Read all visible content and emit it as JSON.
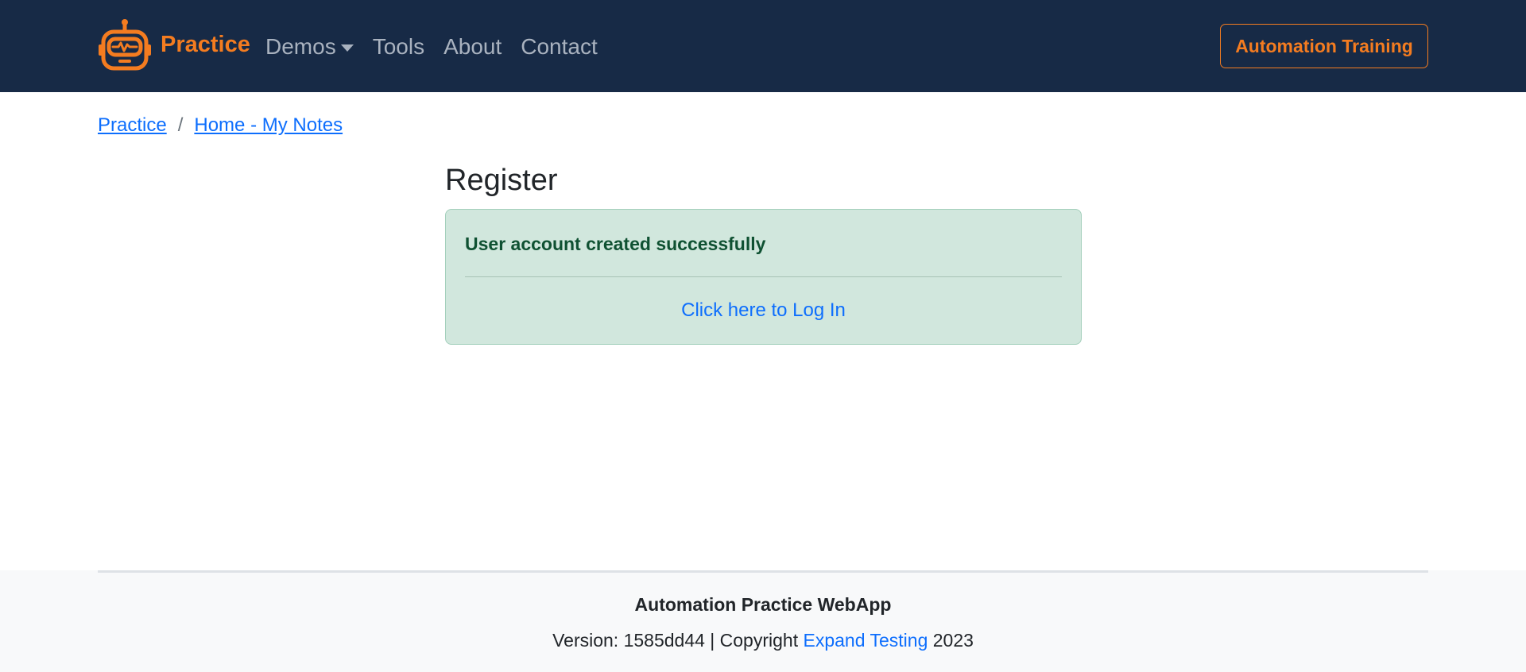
{
  "nav": {
    "brand_label": "Practice",
    "brand_icon": "robot-icon",
    "links": [
      {
        "label": "Demos",
        "dropdown": true
      },
      {
        "label": "Tools"
      },
      {
        "label": "About"
      },
      {
        "label": "Contact"
      }
    ],
    "cta_label": "Automation Training"
  },
  "breadcrumb": {
    "items": [
      "Practice",
      "Home - My Notes"
    ],
    "separator": "/"
  },
  "main": {
    "title": "Register",
    "alert": {
      "heading": "User account created successfully",
      "link_label": "Click here to Log In"
    }
  },
  "footer": {
    "title": "Automation Practice WebApp",
    "version_prefix": "Version: 1585dd44 | Copyright ",
    "company_link": "Expand Testing",
    "year": " 2023"
  },
  "colors": {
    "navbar_bg": "#172a46",
    "accent_orange": "#f47c20",
    "link_blue": "#0d6efd",
    "alert_bg": "#d1e7dd",
    "alert_text": "#0f5132",
    "footer_bg": "#f8f9fa"
  }
}
